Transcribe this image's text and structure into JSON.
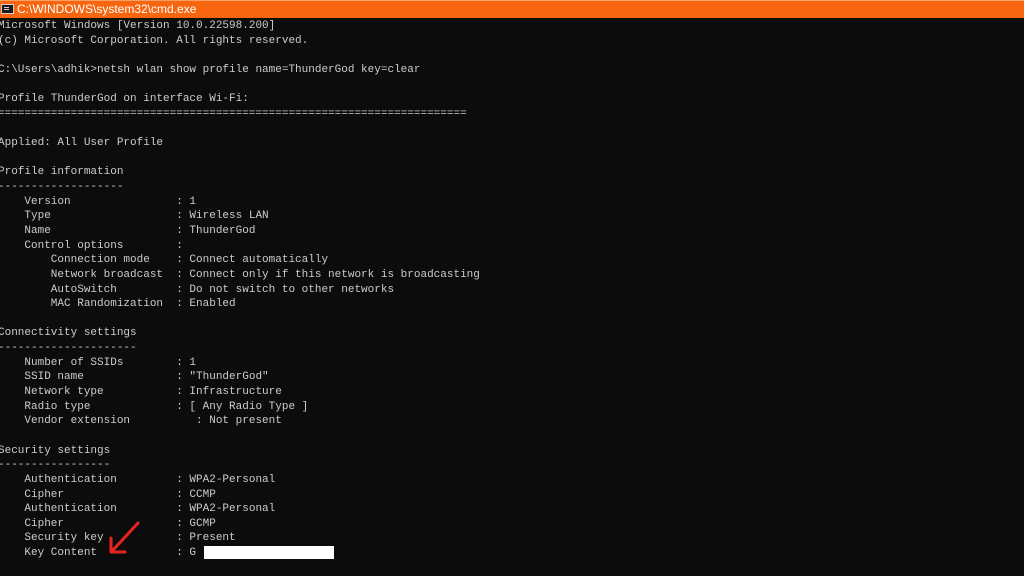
{
  "window": {
    "title": "C:\\WINDOWS\\system32\\cmd.exe",
    "icon": "cmd-icon",
    "titlebar_color": "#f7660f"
  },
  "console": {
    "lines": [
      "Microsoft Windows [Version 10.0.22598.200]",
      "(c) Microsoft Corporation. All rights reserved.",
      "",
      "C:\\Users\\adhik>netsh wlan show profile name=ThunderGod key=clear",
      "",
      "Profile ThunderGod on interface Wi-Fi:",
      "=======================================================================",
      "",
      "Applied: All User Profile",
      "",
      "Profile information",
      "-------------------",
      "    Version                : 1",
      "    Type                   : Wireless LAN",
      "    Name                   : ThunderGod",
      "    Control options        :",
      "        Connection mode    : Connect automatically",
      "        Network broadcast  : Connect only if this network is broadcasting",
      "        AutoSwitch         : Do not switch to other networks",
      "        MAC Randomization  : Enabled",
      "",
      "Connectivity settings",
      "---------------------",
      "    Number of SSIDs        : 1",
      "    SSID name              : \"ThunderGod\"",
      "    Network type           : Infrastructure",
      "    Radio type             : [ Any Radio Type ]",
      "    Vendor extension          : Not present",
      "",
      "Security settings",
      "-----------------",
      "    Authentication         : WPA2-Personal",
      "    Cipher                 : CCMP",
      "    Authentication         : WPA2-Personal",
      "    Cipher                 : GCMP",
      "    Security key           : Present",
      "    Key Content            : G"
    ]
  },
  "annotations": {
    "arrow_icon": "red-arrow-pointing-to-key-content",
    "arrow_color": "#e8231f",
    "redaction_color": "#ffffff"
  }
}
